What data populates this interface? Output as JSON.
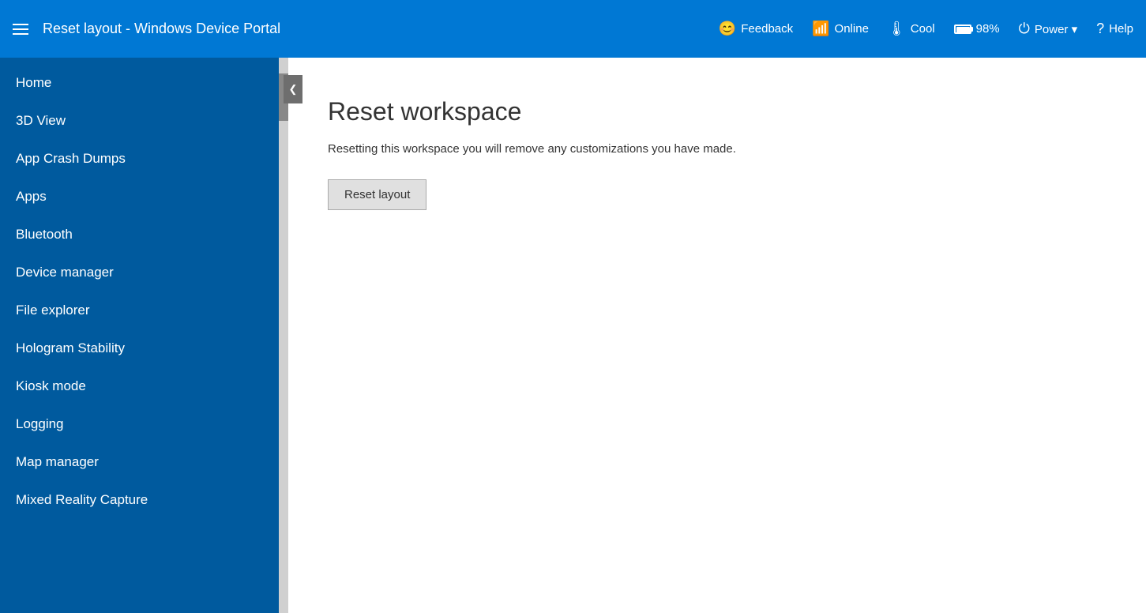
{
  "header": {
    "title": "Reset layout - Windows Device Portal",
    "hamburger_label": "Menu",
    "actions": {
      "feedback": {
        "label": "Feedback",
        "icon": "😊"
      },
      "online": {
        "label": "Online",
        "icon": "📶"
      },
      "cool": {
        "label": "Cool",
        "icon": "🌡"
      },
      "battery": {
        "label": "98%",
        "icon": "🔋"
      },
      "power": {
        "label": "Power ▾",
        "icon": "⏻"
      },
      "help": {
        "label": "Help",
        "icon": "?"
      }
    }
  },
  "sidebar": {
    "collapse_label": "❮",
    "items": [
      {
        "id": "home",
        "label": "Home",
        "active": false
      },
      {
        "id": "3d-view",
        "label": "3D View",
        "active": false
      },
      {
        "id": "app-crash-dumps",
        "label": "App Crash Dumps",
        "active": false
      },
      {
        "id": "apps",
        "label": "Apps",
        "active": false
      },
      {
        "id": "bluetooth",
        "label": "Bluetooth",
        "active": false
      },
      {
        "id": "device-manager",
        "label": "Device manager",
        "active": false
      },
      {
        "id": "file-explorer",
        "label": "File explorer",
        "active": false
      },
      {
        "id": "hologram-stability",
        "label": "Hologram Stability",
        "active": false
      },
      {
        "id": "kiosk-mode",
        "label": "Kiosk mode",
        "active": false
      },
      {
        "id": "logging",
        "label": "Logging",
        "active": false
      },
      {
        "id": "map-manager",
        "label": "Map manager",
        "active": false
      },
      {
        "id": "mixed-reality-capture",
        "label": "Mixed Reality Capture",
        "active": false
      }
    ]
  },
  "content": {
    "title": "Reset workspace",
    "description": "Resetting this workspace you will remove any customizations you have made.",
    "reset_button_label": "Reset layout"
  }
}
